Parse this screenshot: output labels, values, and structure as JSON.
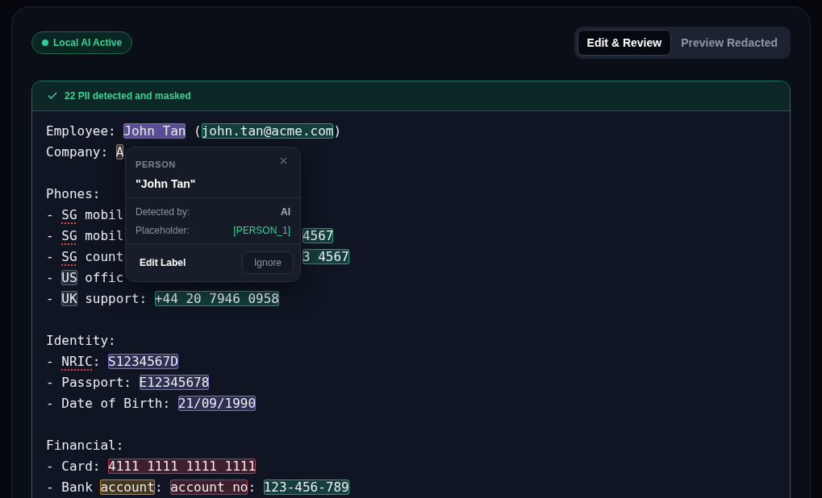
{
  "status_badge": {
    "label": "Local AI Active",
    "on": true
  },
  "view_tabs": [
    {
      "label": "Edit & Review",
      "selected": true
    },
    {
      "label": "Preview Redacted",
      "selected": false
    }
  ],
  "detection_banner": {
    "text": "22 PII detected and masked"
  },
  "document": {
    "lines": [
      {
        "kind": "text",
        "segments": [
          {
            "kind": "plain",
            "text": "Employee: "
          },
          {
            "kind": "highlight",
            "text": "John Tan",
            "color": "#7c6ac7",
            "selected": true
          },
          {
            "kind": "plain",
            "text": " ("
          },
          {
            "kind": "highlight",
            "text": "john.tan@acme.com",
            "color": "#1e9e78",
            "selected": false
          },
          {
            "kind": "plain",
            "text": ")"
          }
        ]
      },
      {
        "kind": "text",
        "segments": [
          {
            "kind": "plain",
            "text": "Company: "
          },
          {
            "kind": "highlight",
            "text": "A",
            "color": "#9c8276",
            "selected": false
          }
        ]
      },
      {
        "kind": "blank"
      },
      {
        "kind": "text",
        "segments": [
          {
            "kind": "plain",
            "text": "Phones:"
          }
        ]
      },
      {
        "kind": "text",
        "segments": [
          {
            "kind": "plain",
            "text": "- "
          },
          {
            "kind": "flagged",
            "text": "SG"
          },
          {
            "kind": "plain",
            "text": " mobil"
          }
        ]
      },
      {
        "kind": "text",
        "segments": [
          {
            "kind": "plain",
            "text": "- "
          },
          {
            "kind": "flagged",
            "text": "SG"
          },
          {
            "kind": "plain",
            "text": " mobil"
          }
        ],
        "after_popup": [
          {
            "kind": "highlight",
            "text": "4567",
            "color": "#1e9e78",
            "selected": false
          }
        ]
      },
      {
        "kind": "text",
        "segments": [
          {
            "kind": "plain",
            "text": "- "
          },
          {
            "kind": "flagged",
            "text": "SG"
          },
          {
            "kind": "plain",
            "text": " count"
          }
        ],
        "after_popup": [
          {
            "kind": "highlight",
            "text": "3 4567",
            "color": "#1e9e78",
            "selected": false
          }
        ]
      },
      {
        "kind": "text",
        "segments": [
          {
            "kind": "plain",
            "text": "- "
          },
          {
            "kind": "highlight",
            "text": "US",
            "color": "#5b6475",
            "selected": false
          },
          {
            "kind": "plain",
            "text": " offic"
          }
        ]
      },
      {
        "kind": "text",
        "segments": [
          {
            "kind": "plain",
            "text": "- "
          },
          {
            "kind": "highlight",
            "text": "UK",
            "color": "#5b6475",
            "selected": false
          },
          {
            "kind": "plain",
            "text": " support: "
          },
          {
            "kind": "highlight",
            "text": "+44 20 7946 0958",
            "color": "#1e9e78",
            "selected": false
          }
        ]
      },
      {
        "kind": "blank"
      },
      {
        "kind": "text",
        "segments": [
          {
            "kind": "plain",
            "text": "Identity:"
          }
        ]
      },
      {
        "kind": "text",
        "segments": [
          {
            "kind": "plain",
            "text": "- "
          },
          {
            "kind": "flagged",
            "text": "NRIC"
          },
          {
            "kind": "plain",
            "text": ": "
          },
          {
            "kind": "highlight",
            "text": "S1234567D",
            "color": "#7c6ac7",
            "selected": false
          }
        ]
      },
      {
        "kind": "text",
        "segments": [
          {
            "kind": "plain",
            "text": "- Passport: "
          },
          {
            "kind": "highlight",
            "text": "E12345678",
            "color": "#7c6ac7",
            "selected": false
          }
        ]
      },
      {
        "kind": "text",
        "segments": [
          {
            "kind": "plain",
            "text": "- Date of Birth: "
          },
          {
            "kind": "highlight",
            "text": "21/09/1990",
            "color": "#7c6ac7",
            "selected": false
          }
        ]
      },
      {
        "kind": "blank"
      },
      {
        "kind": "text",
        "segments": [
          {
            "kind": "plain",
            "text": "Financial:"
          }
        ]
      },
      {
        "kind": "text",
        "segments": [
          {
            "kind": "plain",
            "text": "- Card: "
          },
          {
            "kind": "highlight",
            "text": "4111 1111 1111 1111",
            "color": "#b3394a",
            "selected": false
          }
        ]
      },
      {
        "kind": "text",
        "segments": [
          {
            "kind": "plain",
            "text": "- Bank "
          },
          {
            "kind": "highlight",
            "text": "account",
            "color": "#c58a1c",
            "selected": false
          },
          {
            "kind": "plain",
            "text": ": "
          },
          {
            "kind": "highlight",
            "text": "account no",
            "color": "#b3394a",
            "selected": false
          },
          {
            "kind": "plain",
            "text": ": "
          },
          {
            "kind": "highlight",
            "text": "123-456-789",
            "color": "#1e9e78",
            "selected": false
          }
        ]
      }
    ]
  },
  "popup": {
    "category": "PERSON",
    "value": "\"John Tan\"",
    "details": [
      {
        "label": "Detected by:",
        "value": "AI",
        "kind": "plain"
      },
      {
        "label": "Placeholder:",
        "value": "[PERSON_1]",
        "kind": "token"
      }
    ],
    "actions": [
      {
        "label": "Edit Label",
        "kind": "ghost"
      },
      {
        "label": "Ignore",
        "kind": "outline"
      }
    ]
  }
}
